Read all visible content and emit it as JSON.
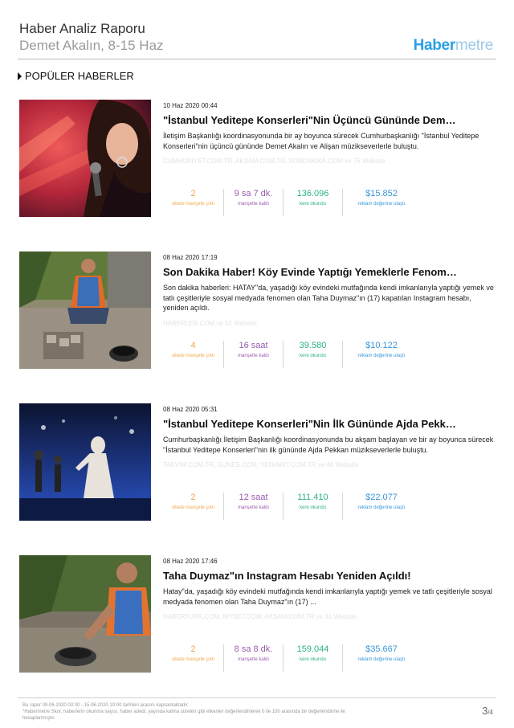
{
  "header": {
    "title": "Haber Analiz Raporu",
    "subtitle": "Demet Akalın, 8-15 Haz",
    "logo_part1": "Haber",
    "logo_part2": "metre"
  },
  "section_title": "POPÜLER HABERLER",
  "articles": [
    {
      "date": "10 Haz 2020 00:44",
      "headline": "\"İstanbul Yeditepe Konserleri\"Nin Üçüncü Gününde Dem…",
      "summary": "İletişim Başkanlığı koordinasyonunda bir ay boyunca sürecek Cumhurbaşkanlığı \"İstanbul Yeditepe Konserleri\"nin üçüncü gününde Demet Akalın ve Alişan müzikseverlerle buluştu.",
      "sources": "CUMHURIYET.COM.TR, AKSAM.COM.TR, SONDAKIKA.COM ve 76 Website",
      "stats": [
        {
          "value": "2",
          "label": "sitede manşete çıktı"
        },
        {
          "value": "9 sa 7 dk.",
          "label": "manşette kaldı"
        },
        {
          "value": "136.096",
          "label": "kere okundu"
        },
        {
          "value": "$15.852",
          "label": "reklam değerine ulaştı"
        }
      ]
    },
    {
      "date": "08 Haz 2020 17:19",
      "headline": "Son Dakika Haber! Köy Evinde Yaptığı Yemeklerle Fenom…",
      "summary": "Son dakika haberleri: HATAY\"da, yaşadığı köy evindeki mutfağında kendi imkanlarıyla yaptığı yemek ve tatlı çeşitleriyle sosyal medyada fenomen olan Taha Duymaz\"ın (17) kapatılan Instagram hesabı, yeniden açıldı.",
      "sources": "HABERLER.COM ve 52 Website",
      "stats": [
        {
          "value": "4",
          "label": "sitede manşete çıktı"
        },
        {
          "value": "16 saat",
          "label": "manşette kaldı"
        },
        {
          "value": "39.580",
          "label": "kere okundu"
        },
        {
          "value": "$10.122",
          "label": "reklam değerine ulaştı"
        }
      ]
    },
    {
      "date": "08 Haz 2020 05:31",
      "headline": "\"İstanbul Yeditepe Konserleri\"Nin İlk Gününde Ajda Pekk…",
      "summary": "Cumhurbaşkanlığı İletişim Başkanlığı koordinasyonunda bu akşam başlayan ve bir ay boyunca sürecek \"İstanbul Yeditepe Konserleri\"nin ilk gününde Ajda Pekkan müzikseverlerle buluştu.",
      "sources": "TAKVIM.COM.TR, GUNES.COM, YENIAKIT.COM.TR ve 46 Website",
      "stats": [
        {
          "value": "2",
          "label": "sitede manşete çıktı"
        },
        {
          "value": "12 saat",
          "label": "manşette kaldı"
        },
        {
          "value": "111.410",
          "label": "kere okundu"
        },
        {
          "value": "$22.077",
          "label": "reklam değerine ulaştı"
        }
      ]
    },
    {
      "date": "08 Haz 2020 17:46",
      "headline": "Taha Duymaz\"ın Instagram Hesabı Yeniden Açıldı!",
      "summary": "Hatay\"da, yaşadığı köy evindeki mutfağında kendi imkanlarıyla yaptığı yemek ve tatlı çeşitleriyle sosyal medyada fenomen olan Taha Duymaz\"ın (17) ...",
      "sources": "HABERTURK.COM, MYNET.COM, AKSAM.COM.TR ve 33 Website",
      "stats": [
        {
          "value": "2",
          "label": "sitede manşete çıktı"
        },
        {
          "value": "8 sa 8 dk.",
          "label": "manşette kaldı"
        },
        {
          "value": "159.044",
          "label": "kere okundu"
        },
        {
          "value": "$35.667",
          "label": "reklam değerine ulaştı"
        }
      ]
    }
  ],
  "footer": {
    "line1": "Bu rapor 08.06.2020 00:00 - 15.06.2020 10:00 tarihleri arasını kapsamaktadır.",
    "line2": "*Habermetre Skor, haberlerin okunma sayısı, haber adedi, yayında kalma süreleri gibi etkenler değerlendirilerek 0 ile 100 arasında bir değerlendirme ile hesaplanmıştır.",
    "page_current": "3",
    "page_total": "/4"
  },
  "colors": {
    "logo_blue": "#2aa1e6",
    "stat_headlines": "#f0a94a",
    "stat_duration": "#9b5bb0",
    "stat_reads": "#2bb08a",
    "stat_ad_value": "#3a97d8"
  }
}
